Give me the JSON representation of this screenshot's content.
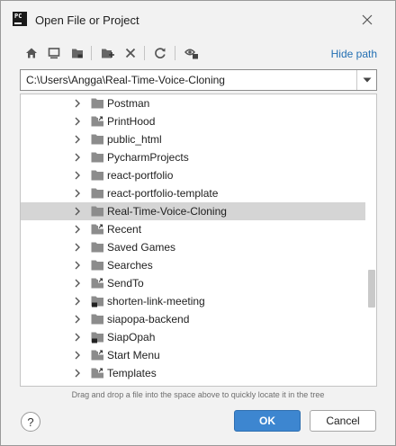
{
  "window": {
    "title": "Open File or Project",
    "logo_text": "PC",
    "close_icon": "close-icon"
  },
  "toolbar": {
    "buttons": [
      {
        "name": "home-icon"
      },
      {
        "name": "desktop-icon"
      },
      {
        "name": "project-folder-icon"
      },
      {
        "name": "new-folder-icon"
      },
      {
        "name": "delete-icon"
      },
      {
        "name": "refresh-icon"
      },
      {
        "name": "show-hidden-icon"
      }
    ],
    "hide_path_label": "Hide path"
  },
  "path": {
    "value": "C:\\Users\\Angga\\Real-Time-Voice-Cloning"
  },
  "tree": {
    "items": [
      {
        "label": "Postman",
        "icon": "folder"
      },
      {
        "label": "PrintHood",
        "icon": "folder-shortcut"
      },
      {
        "label": "public_html",
        "icon": "folder"
      },
      {
        "label": "PycharmProjects",
        "icon": "folder"
      },
      {
        "label": "react-portfolio",
        "icon": "folder"
      },
      {
        "label": "react-portfolio-template",
        "icon": "folder"
      },
      {
        "label": "Real-Time-Voice-Cloning",
        "icon": "folder",
        "selected": true
      },
      {
        "label": "Recent",
        "icon": "folder-shortcut"
      },
      {
        "label": "Saved Games",
        "icon": "folder"
      },
      {
        "label": "Searches",
        "icon": "folder"
      },
      {
        "label": "SendTo",
        "icon": "folder-shortcut"
      },
      {
        "label": "shorten-link-meeting",
        "icon": "folder-project"
      },
      {
        "label": "siapopa-backend",
        "icon": "folder"
      },
      {
        "label": "SiapOpah",
        "icon": "folder-project"
      },
      {
        "label": "Start Menu",
        "icon": "folder-shortcut"
      },
      {
        "label": "Templates",
        "icon": "folder-shortcut"
      }
    ]
  },
  "hint": "Drag and drop a file into the space above to quickly locate it in the tree",
  "buttons": {
    "help_label": "?",
    "ok_label": "OK",
    "cancel_label": "Cancel"
  },
  "colors": {
    "accent": "#3d86d0",
    "link": "#2470b3",
    "selection": "#d5d5d5",
    "folder": "#8c8c8c"
  }
}
